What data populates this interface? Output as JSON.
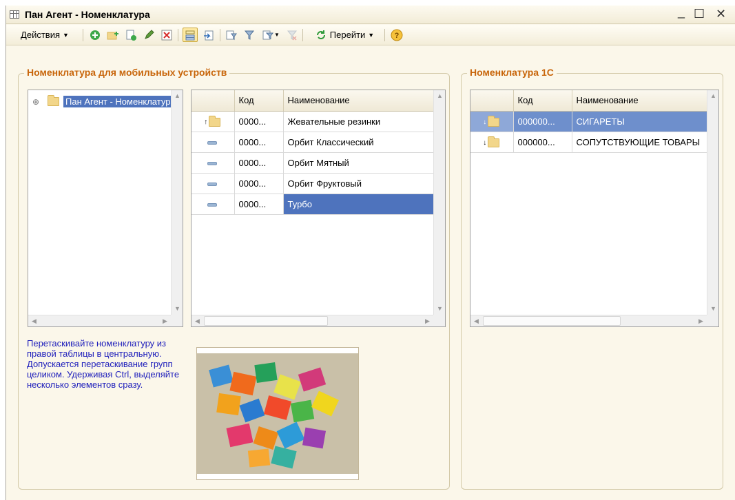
{
  "window": {
    "title": "Пан Агент - Номенклатура",
    "controls": [
      "_",
      "☐",
      "✕"
    ]
  },
  "toolbar": {
    "actions_label": "Действия",
    "goto_label": "Перейти",
    "icons": [
      "add-icon",
      "add-folder-icon",
      "copy-icon",
      "edit-icon",
      "delete-icon",
      "hierarchy-icon",
      "move-to-group-icon",
      "filter-icon",
      "filter-selected-icon",
      "filter-dropdown-icon",
      "clear-filter-icon",
      "refresh-icon",
      "help-icon"
    ]
  },
  "left_group": {
    "title": "Номенклатура для мобильных устройств",
    "tree": {
      "root_label": "Пан Агент - Номенклатура"
    },
    "table": {
      "columns": [
        "",
        "Код",
        "Наименование"
      ],
      "rows": [
        {
          "type": "folder",
          "code": "0000...",
          "name": "Жевательные резинки"
        },
        {
          "type": "item",
          "code": "0000...",
          "name": "Орбит Классический"
        },
        {
          "type": "item",
          "code": "0000...",
          "name": "Орбит Мятный"
        },
        {
          "type": "item",
          "code": "0000...",
          "name": "Орбит Фруктовый"
        },
        {
          "type": "item",
          "code": "0000...",
          "name": "Турбо",
          "selected": true
        }
      ]
    },
    "help_text": "Перетаскивайте номенклатуру из правой таблицы в центральную. Допускается перетаскивание групп целиком. Удерживая Ctrl, выделяйте несколько элементов сразу."
  },
  "right_group": {
    "title": "Номенклатура 1С",
    "table": {
      "columns": [
        "",
        "Код",
        "Наименование"
      ],
      "rows": [
        {
          "type": "folder",
          "code": "000000...",
          "name": "СИГАРЕТЫ",
          "selected": true
        },
        {
          "type": "folder",
          "code": "000000...",
          "name": "СОПУТСТВУЮЩИЕ ТОВАРЫ"
        }
      ]
    }
  },
  "colors": {
    "accent_title": "#c8650a",
    "selection": "#4e73bd",
    "help_text": "#1d1dbb",
    "window_bg": "#fbf7ea"
  }
}
